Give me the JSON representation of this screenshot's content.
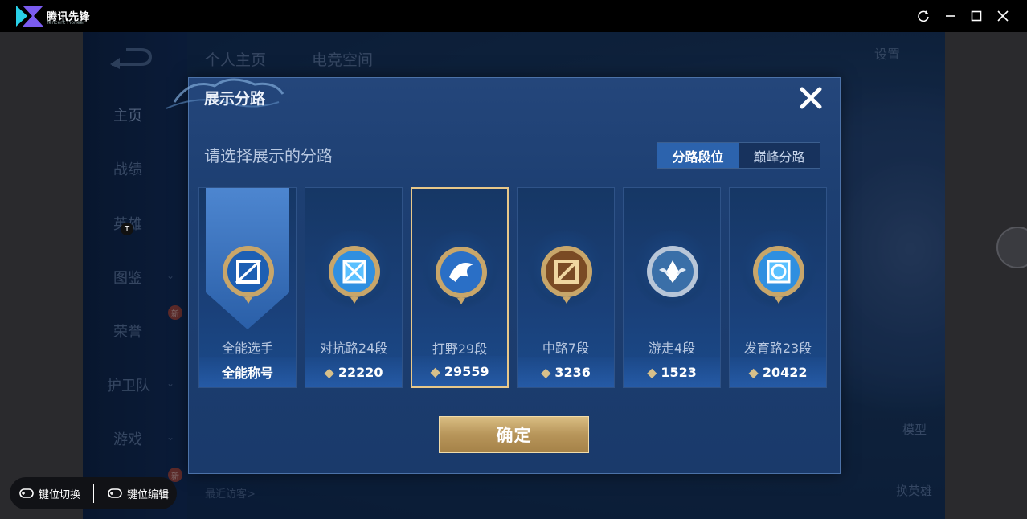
{
  "app": {
    "name": "腾讯先锋",
    "sub": "Tencent Pioneer"
  },
  "game": {
    "top_tabs": [
      "个人主页",
      "电竞空间"
    ],
    "settings": "设置",
    "nav": [
      {
        "label": "主页"
      },
      {
        "label": "战绩"
      },
      {
        "label": "英雄"
      },
      {
        "label": "图鉴"
      },
      {
        "label": "荣誉"
      },
      {
        "label": "护卫队"
      },
      {
        "label": "游戏"
      }
    ],
    "new_badge": "新",
    "right_buttons": [
      "模型",
      "换英雄"
    ],
    "recent_visitors": "最近访客>"
  },
  "dialog": {
    "title": "展示分路",
    "subtitle": "请选择展示的分路",
    "toggle": [
      "分路段位",
      "巅峰分路"
    ],
    "cards": [
      {
        "label": "全能选手",
        "score": "全能称号",
        "selected": false
      },
      {
        "label": "对抗路24段",
        "score": "22220",
        "selected": false
      },
      {
        "label": "打野29段",
        "score": "29559",
        "selected": true
      },
      {
        "label": "中路7段",
        "score": "3236",
        "selected": false
      },
      {
        "label": "游走4段",
        "score": "1523",
        "selected": false
      },
      {
        "label": "发育路23段",
        "score": "20422",
        "selected": false
      }
    ],
    "confirm": "确定"
  },
  "toolbar": {
    "key_switch": "键位切换",
    "key_edit": "键位编辑",
    "t_badge": "T"
  },
  "colors": {
    "accent": "#2c63ad",
    "gold": "#c8a66a"
  }
}
